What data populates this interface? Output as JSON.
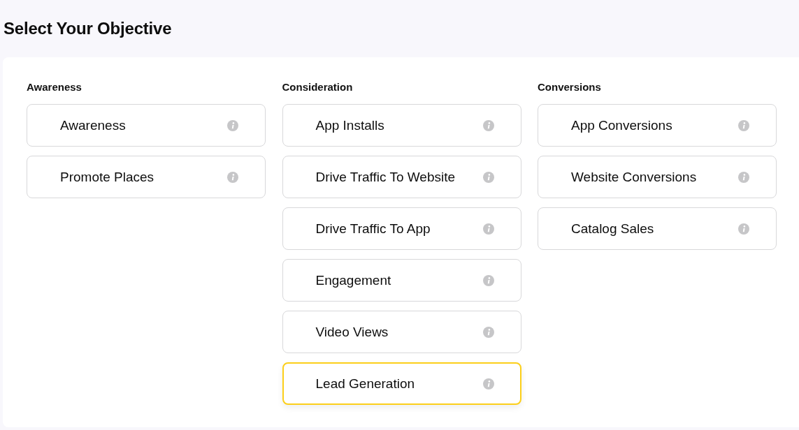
{
  "title": "Select Your Objective",
  "groups": [
    {
      "heading": "Awareness",
      "objectives": [
        {
          "label": "Awareness",
          "selected": false
        },
        {
          "label": "Promote Places",
          "selected": false
        }
      ]
    },
    {
      "heading": "Consideration",
      "objectives": [
        {
          "label": "App Installs",
          "selected": false
        },
        {
          "label": "Drive Traffic To Website",
          "selected": false
        },
        {
          "label": "Drive Traffic To App",
          "selected": false
        },
        {
          "label": "Engagement",
          "selected": false
        },
        {
          "label": "Video Views",
          "selected": false
        },
        {
          "label": "Lead Generation",
          "selected": true
        }
      ]
    },
    {
      "heading": "Conversions",
      "objectives": [
        {
          "label": "App Conversions",
          "selected": false
        },
        {
          "label": "Website Conversions",
          "selected": false
        },
        {
          "label": "Catalog Sales",
          "selected": false
        }
      ]
    }
  ]
}
